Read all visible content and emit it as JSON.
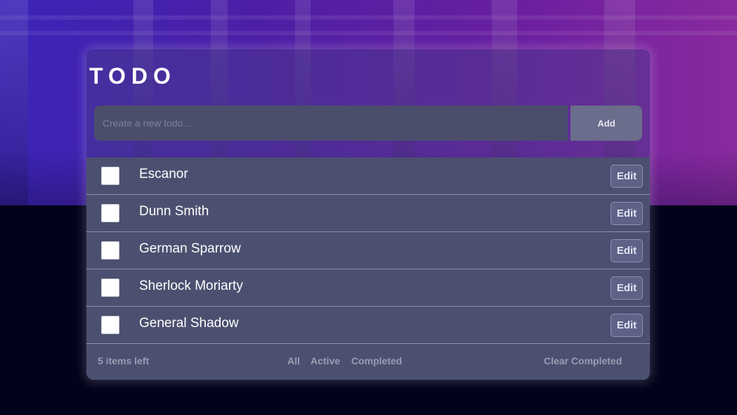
{
  "app": {
    "title": "TODO"
  },
  "new_todo": {
    "placeholder": "Create a new todo...",
    "add_label": "Add"
  },
  "todos": [
    {
      "text": "Escanor",
      "completed": false,
      "edit_label": "Edit"
    },
    {
      "text": "Dunn Smith",
      "completed": false,
      "edit_label": "Edit"
    },
    {
      "text": "German Sparrow",
      "completed": false,
      "edit_label": "Edit"
    },
    {
      "text": "Sherlock Moriarty",
      "completed": false,
      "edit_label": "Edit"
    },
    {
      "text": "General Shadow",
      "completed": false,
      "edit_label": "Edit"
    }
  ],
  "footer": {
    "items_left": "5 items left",
    "filters": [
      "All",
      "Active",
      "Completed"
    ],
    "clear_label": "Clear Completed"
  },
  "colors": {
    "hero_start": "#3b24b8",
    "hero_end": "#8a2a9e",
    "page_bg": "#02021a",
    "row_bg": "#4c5070",
    "input_bg": "#4b4e6b",
    "add_bg": "#6b6d8c"
  }
}
